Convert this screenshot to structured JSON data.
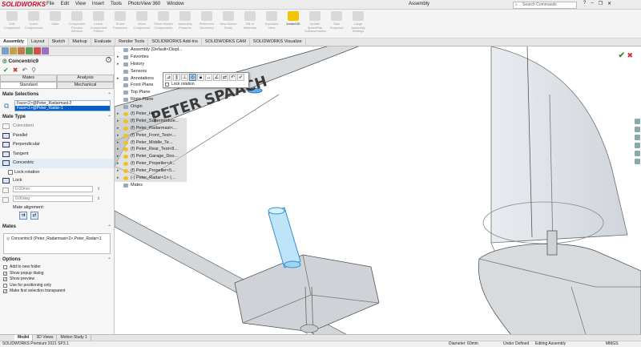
{
  "app": {
    "brand": "SOLIDWORKS",
    "doc_title": "Assembly",
    "menus": [
      "File",
      "Edit",
      "View",
      "Insert",
      "Tools",
      "PhotoView 360",
      "Window"
    ],
    "search_placeholder": "Search Commands"
  },
  "ribbon": {
    "buttons": [
      "Edit Component",
      "Insert Components",
      "Mate",
      "Component Preview Window",
      "Linear Component Pattern",
      "Smart Fasteners",
      "Move Component",
      "Show Hidden Components",
      "Assembly Features",
      "Reference Geometry",
      "New Motion Study",
      "Bill of Materials",
      "Exploded View",
      "Instant3D",
      "Update SpeedPak Subassemblies",
      "Take Snapshot",
      "Large Assembly Settings"
    ]
  },
  "tabs": [
    "Assembly",
    "Layout",
    "Sketch",
    "Markup",
    "Evaluate",
    "Render Tools",
    "SOLIDWORKS Add-Ins",
    "SOLIDWORKS CAM",
    "SOLIDWORKS Visualize"
  ],
  "panel": {
    "title": "Concentric9",
    "help": "?",
    "seg1": [
      "Mates",
      "Analysis"
    ],
    "seg2": [
      "Standard",
      "Mechanical"
    ],
    "mate_selections_title": "Mate Selections",
    "selections": [
      "Face<2>@Peter_Radarmast-2",
      "Face<1>@Peter_Radar-1"
    ],
    "mate_type_title": "Mate Type",
    "mate_types": [
      "Coincident",
      "Parallel",
      "Perpendicular",
      "Tangent",
      "Concentric"
    ],
    "lock_rotation": "Lock rotation",
    "lock": "Lock",
    "distance": "0.00mm",
    "angle": "0.00deg",
    "mate_alignment": "Mate alignment:",
    "mates_title": "Mates",
    "mate_entry": "Concentric9 (Peter_Radarmast<2>,Peter_Radar<1",
    "options_title": "Options",
    "options": [
      "Add to new folder",
      "Show popup dialog",
      "Show preview",
      "Use for positioning only",
      "Make first selection transparent"
    ],
    "options_checked": [
      false,
      true,
      true,
      false,
      true
    ]
  },
  "tree": {
    "root": "Assembly (Default<Displ...",
    "items": [
      "Favorites",
      "History",
      "Sensors",
      "Annotations",
      "Front Plane",
      "Top Plane",
      "Right Plane",
      "Origin",
      "(f) Peter_Hu...",
      "(f) Peter_Supermodule...",
      "(f) Peter_Radarmast<...",
      "(f) Peter_Front_Test<...",
      "(f) Peter_Middle_Te...",
      "(f) Peter_Rear_Test<8...",
      "(f) Peter_Garage_Doo...",
      "(f) Peter_Propeller<4...",
      "(f) Peter_Propeller<5...",
      "(-) Peter_Radar<1> (...",
      "Mates"
    ]
  },
  "popup": {
    "lock_rotation": "Lock rotation"
  },
  "model_text": "PETER SPAACH",
  "bottom_tabs": [
    "Model",
    "3D Views",
    "Motion Study 1"
  ],
  "status": {
    "version": "SOLIDWORKS Premium 2021 SP3.1",
    "diameter": "Diameter: 60mm",
    "defined": "Under Defined",
    "editing": "Editing Assembly",
    "units": "MMGS"
  }
}
